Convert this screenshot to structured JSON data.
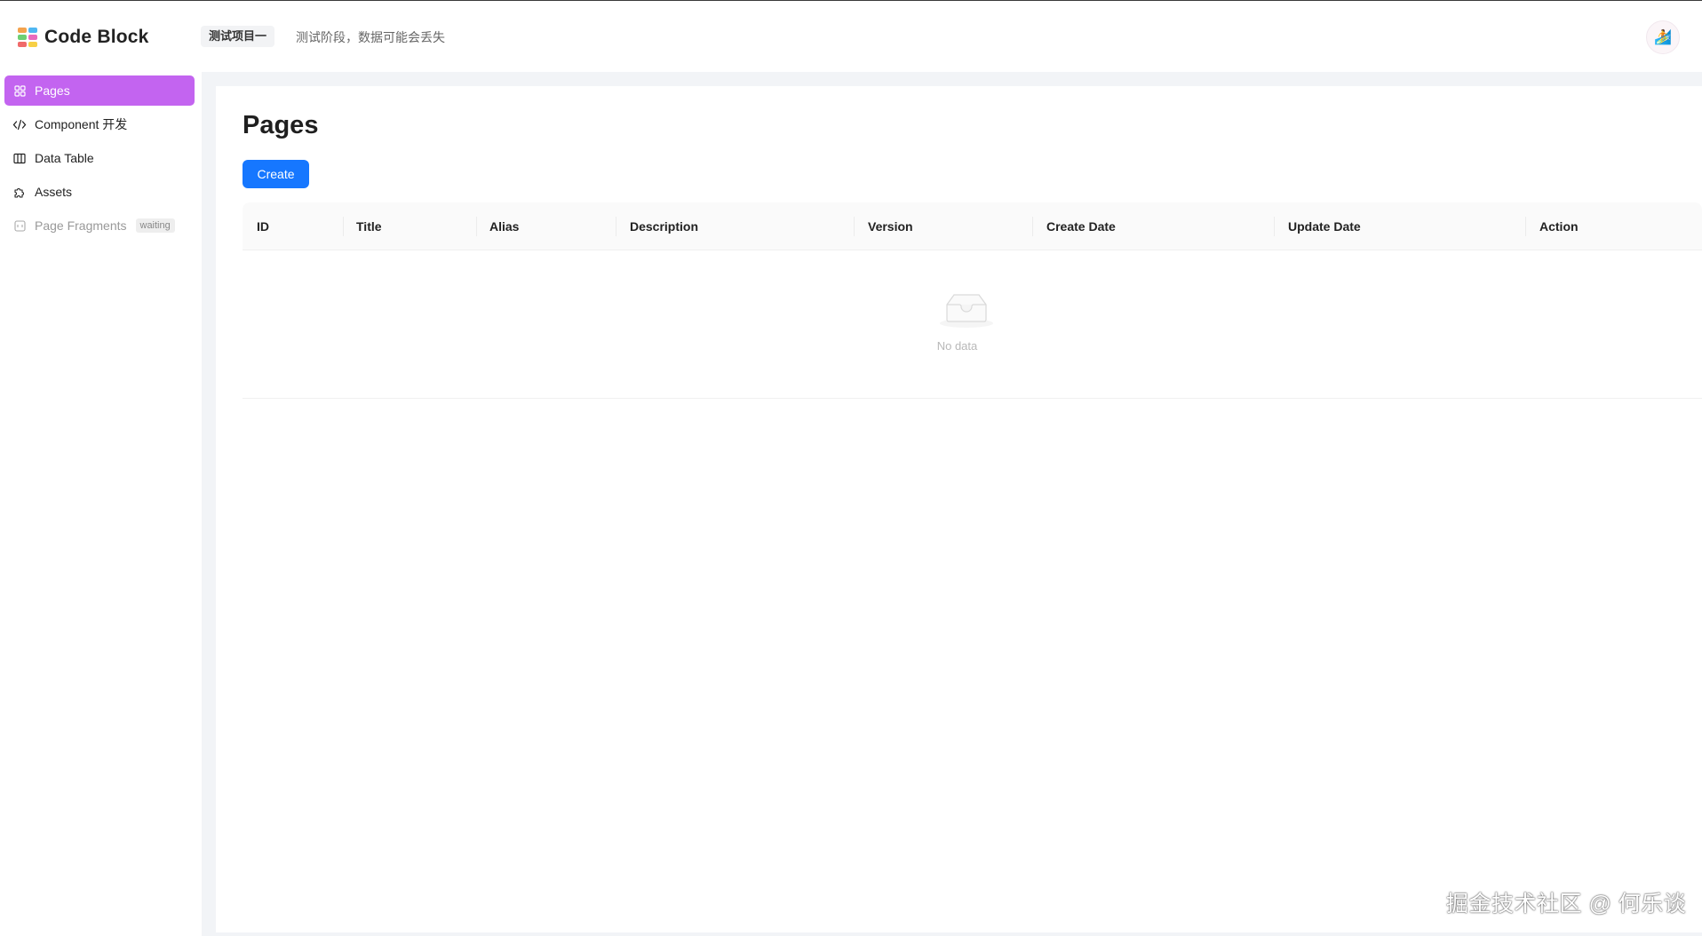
{
  "header": {
    "app_name": "Code Block",
    "project_tag": "测试项目一",
    "notice": "测试阶段，数据可能会丢失",
    "avatar_glyph": "🏄",
    "logo_colors": [
      "#f4a34d",
      "#4fb7f2",
      "#6dcf73",
      "#e96bbd",
      "#f06a6a",
      "#f7d046"
    ]
  },
  "sidebar": {
    "items": [
      {
        "label": "Pages",
        "icon": "grid-icon"
      },
      {
        "label": "Component 开发",
        "icon": "code-icon"
      },
      {
        "label": "Data Table",
        "icon": "table-icon"
      },
      {
        "label": "Assets",
        "icon": "puzzle-icon"
      },
      {
        "label": "Page Fragments",
        "icon": "fragment-icon",
        "badge": "waiting"
      }
    ],
    "active_color": "#c364f0"
  },
  "main": {
    "title": "Pages",
    "create_label": "Create",
    "columns": [
      "ID",
      "Title",
      "Alias",
      "Description",
      "Version",
      "Create Date",
      "Update Date",
      "Action"
    ],
    "empty_text": "No data"
  },
  "watermark": "掘金技术社区 @ 何乐谈",
  "colors": {
    "primary": "#1677ff",
    "background": "#f2f4f7"
  }
}
